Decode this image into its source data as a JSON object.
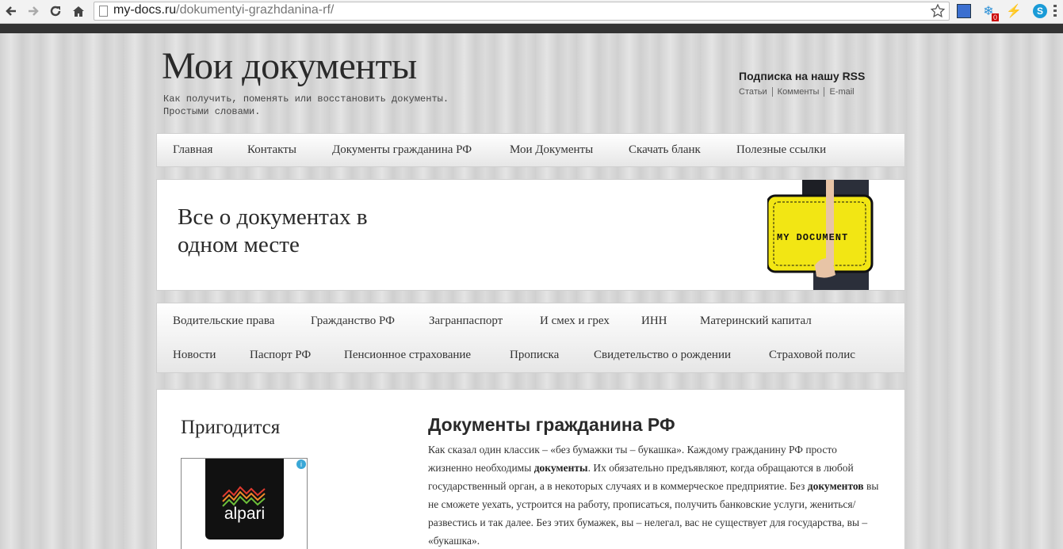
{
  "browser": {
    "url_host": "my-docs.ru",
    "url_path": "/dokumentyi-grazhdanina-rf/",
    "extension_badge": "0"
  },
  "header": {
    "site_title": "Мои документы",
    "tagline_line1": "Как получить, поменять или восстановить документы.",
    "tagline_line2": "Простыми словами.",
    "rss_title": "Подписка на нашу RSS",
    "rss_links": [
      "Статьи",
      "Комменты",
      "E-mail"
    ]
  },
  "top_menu": [
    "Главная",
    "Контакты",
    "Документы гражданина РФ",
    "Мои Документы",
    "Скачать бланк",
    "Полезные ссылки"
  ],
  "banner": {
    "text": "Все о документах в одном месте",
    "image_caption": "MY DOCUMENT"
  },
  "category_menu_row1": [
    "Водительские права",
    "Гражданство РФ",
    "Загранпаспорт",
    "И смех и грех",
    "ИНН",
    "Материнский капитал"
  ],
  "category_menu_row2": [
    "Новости",
    "Паспорт РФ",
    "Пенсионное страхование",
    "Прописка",
    "Свидетельство о рождении",
    "Страховой полис"
  ],
  "sidebar": {
    "title": "Пригодится",
    "ad_brand": "alpari",
    "ad_info": "i"
  },
  "article": {
    "title": "Документы гражданина РФ",
    "p1": "Как сказал один классик – «без бумажки ты – букашка». Каждому гражданину РФ просто жизненно необходимы ",
    "b1": "документы",
    "p2": ". Их обязательно предъявляют, когда обращаются в любой государственный орган, а в некоторых случаях и в коммерческое предприятие. Без ",
    "b2": "документов",
    "p3": " вы не сможете уехать, устроится на работу, прописаться, получить банковские услуги, жениться/развестись и так далее. Без этих бумажек, вы – нелегал, вас не существует для государства, вы – «букашка»."
  }
}
